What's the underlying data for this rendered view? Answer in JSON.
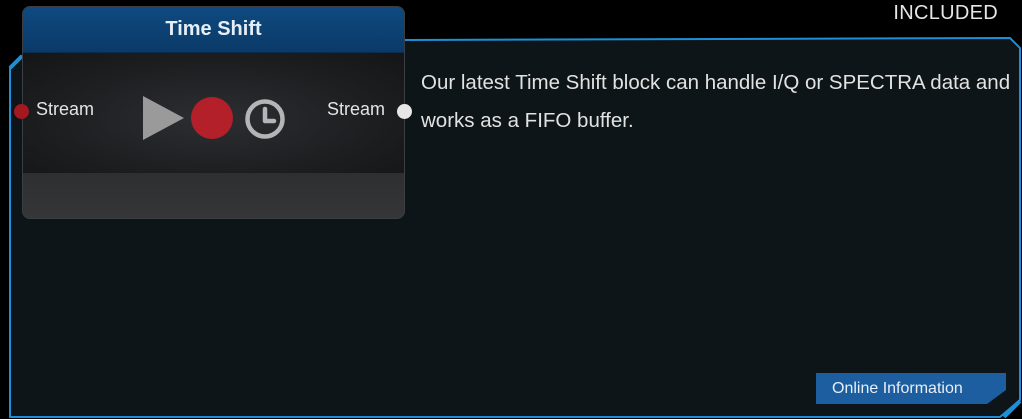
{
  "badge": "INCLUDED",
  "node": {
    "title": "Time Shift",
    "input_port_label": "Stream",
    "output_port_label": "Stream",
    "icons": [
      "play-icon",
      "record-icon",
      "clock-icon"
    ]
  },
  "description": "Our latest Time Shift block can handle I/Q or SPECTRA data and works as a FIFO buffer.",
  "online_button_label": "Online Information",
  "colors": {
    "frame_accent": "#1e8fd6",
    "panel_bg": "#0e1518",
    "header_blue": "#0c4478",
    "record_red": "#b3202a",
    "play_gray": "#9a9a9a",
    "button_blue": "#1c5ea0"
  }
}
